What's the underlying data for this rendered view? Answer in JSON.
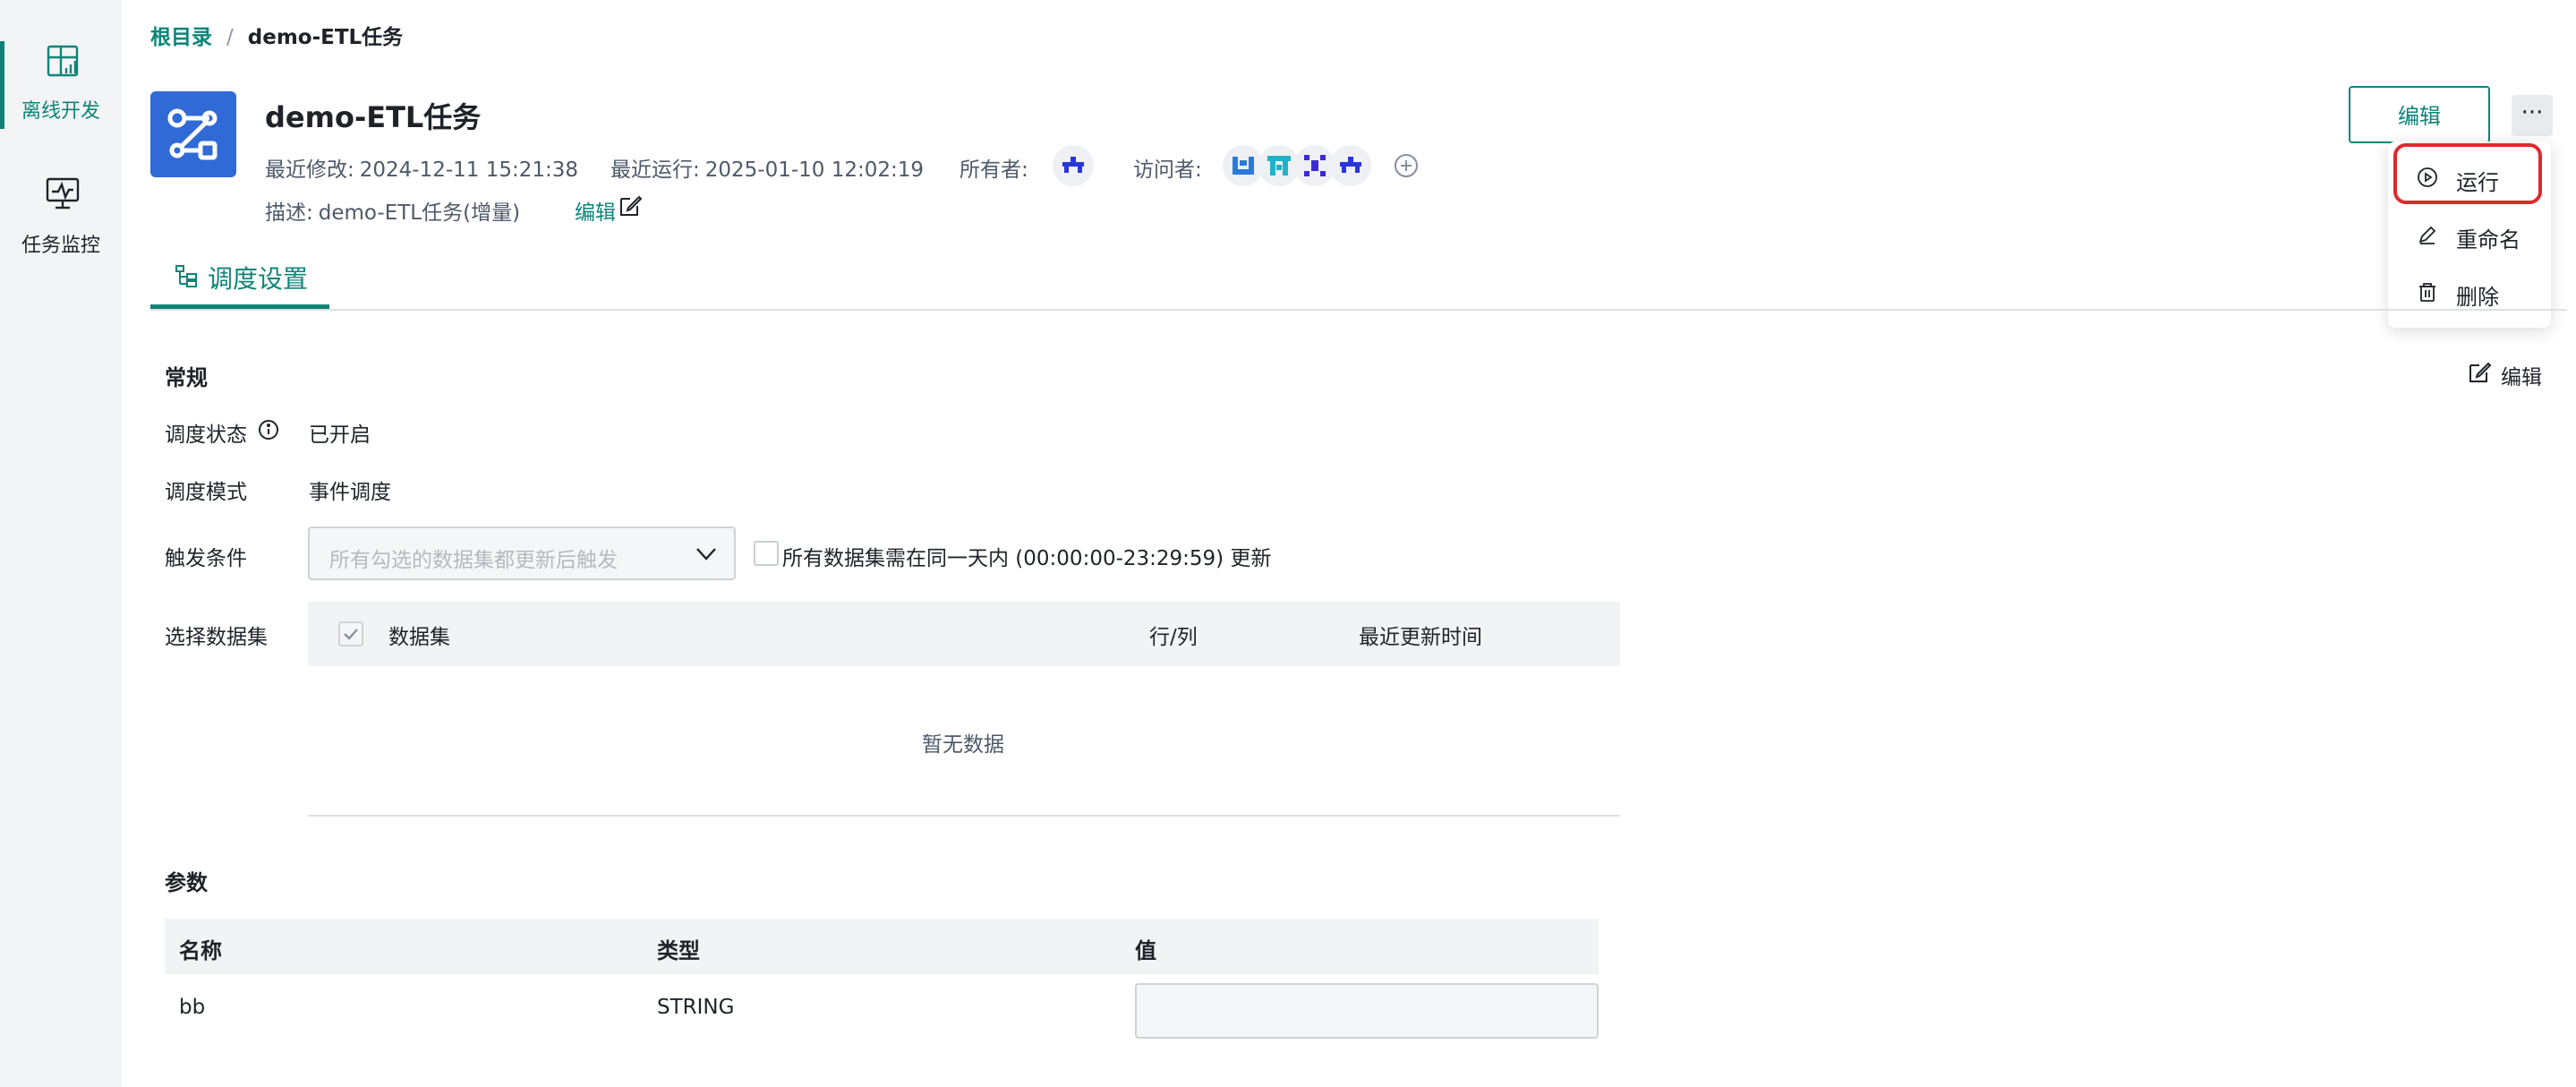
{
  "sidebar": {
    "items": [
      {
        "label": "离线开发",
        "icon": "offline-dev-icon",
        "active": true
      },
      {
        "label": "任务监控",
        "icon": "monitor-icon",
        "active": false
      }
    ]
  },
  "breadcrumb": {
    "root": "根目录",
    "separator": "/",
    "current": "demo-ETL任务"
  },
  "task": {
    "title": "demo-ETL任务",
    "last_modified_label": "最近修改:",
    "last_modified": "2024-12-11 15:21:38",
    "last_run_label": "最近运行:",
    "last_run": "2025-01-10 12:02:19",
    "owner_label": "所有者:",
    "visitor_label": "访问者:",
    "desc_label": "描述:",
    "desc": "demo-ETL任务(增量)",
    "desc_edit": "编辑"
  },
  "actions": {
    "edit": "编辑",
    "more": "···"
  },
  "more_menu": {
    "run": "运行",
    "rename": "重命名",
    "delete": "删除"
  },
  "tabs": [
    {
      "label": "调度设置",
      "active": true
    }
  ],
  "general": {
    "title": "常规",
    "edit": "编辑",
    "status_label": "调度状态",
    "status": "已开启",
    "mode_label": "调度模式",
    "mode": "事件调度",
    "trigger_label": "触发条件",
    "trigger_placeholder": "所有勾选的数据集都更新后触发",
    "same_day_label": "所有数据集需在同一天内 (00:00:00-23:29:59) 更新",
    "dataset_label": "选择数据集",
    "dataset_columns": [
      "数据集",
      "行/列",
      "最近更新时间"
    ],
    "empty": "暂无数据"
  },
  "params": {
    "title": "参数",
    "columns": [
      "名称",
      "类型",
      "值"
    ],
    "rows": [
      {
        "name": "bb",
        "type": "STRING",
        "value": ""
      }
    ]
  },
  "colors": {
    "accent": "#0e8478",
    "task_icon_bg": "#2f6ad6",
    "highlight": "#e0282e"
  }
}
